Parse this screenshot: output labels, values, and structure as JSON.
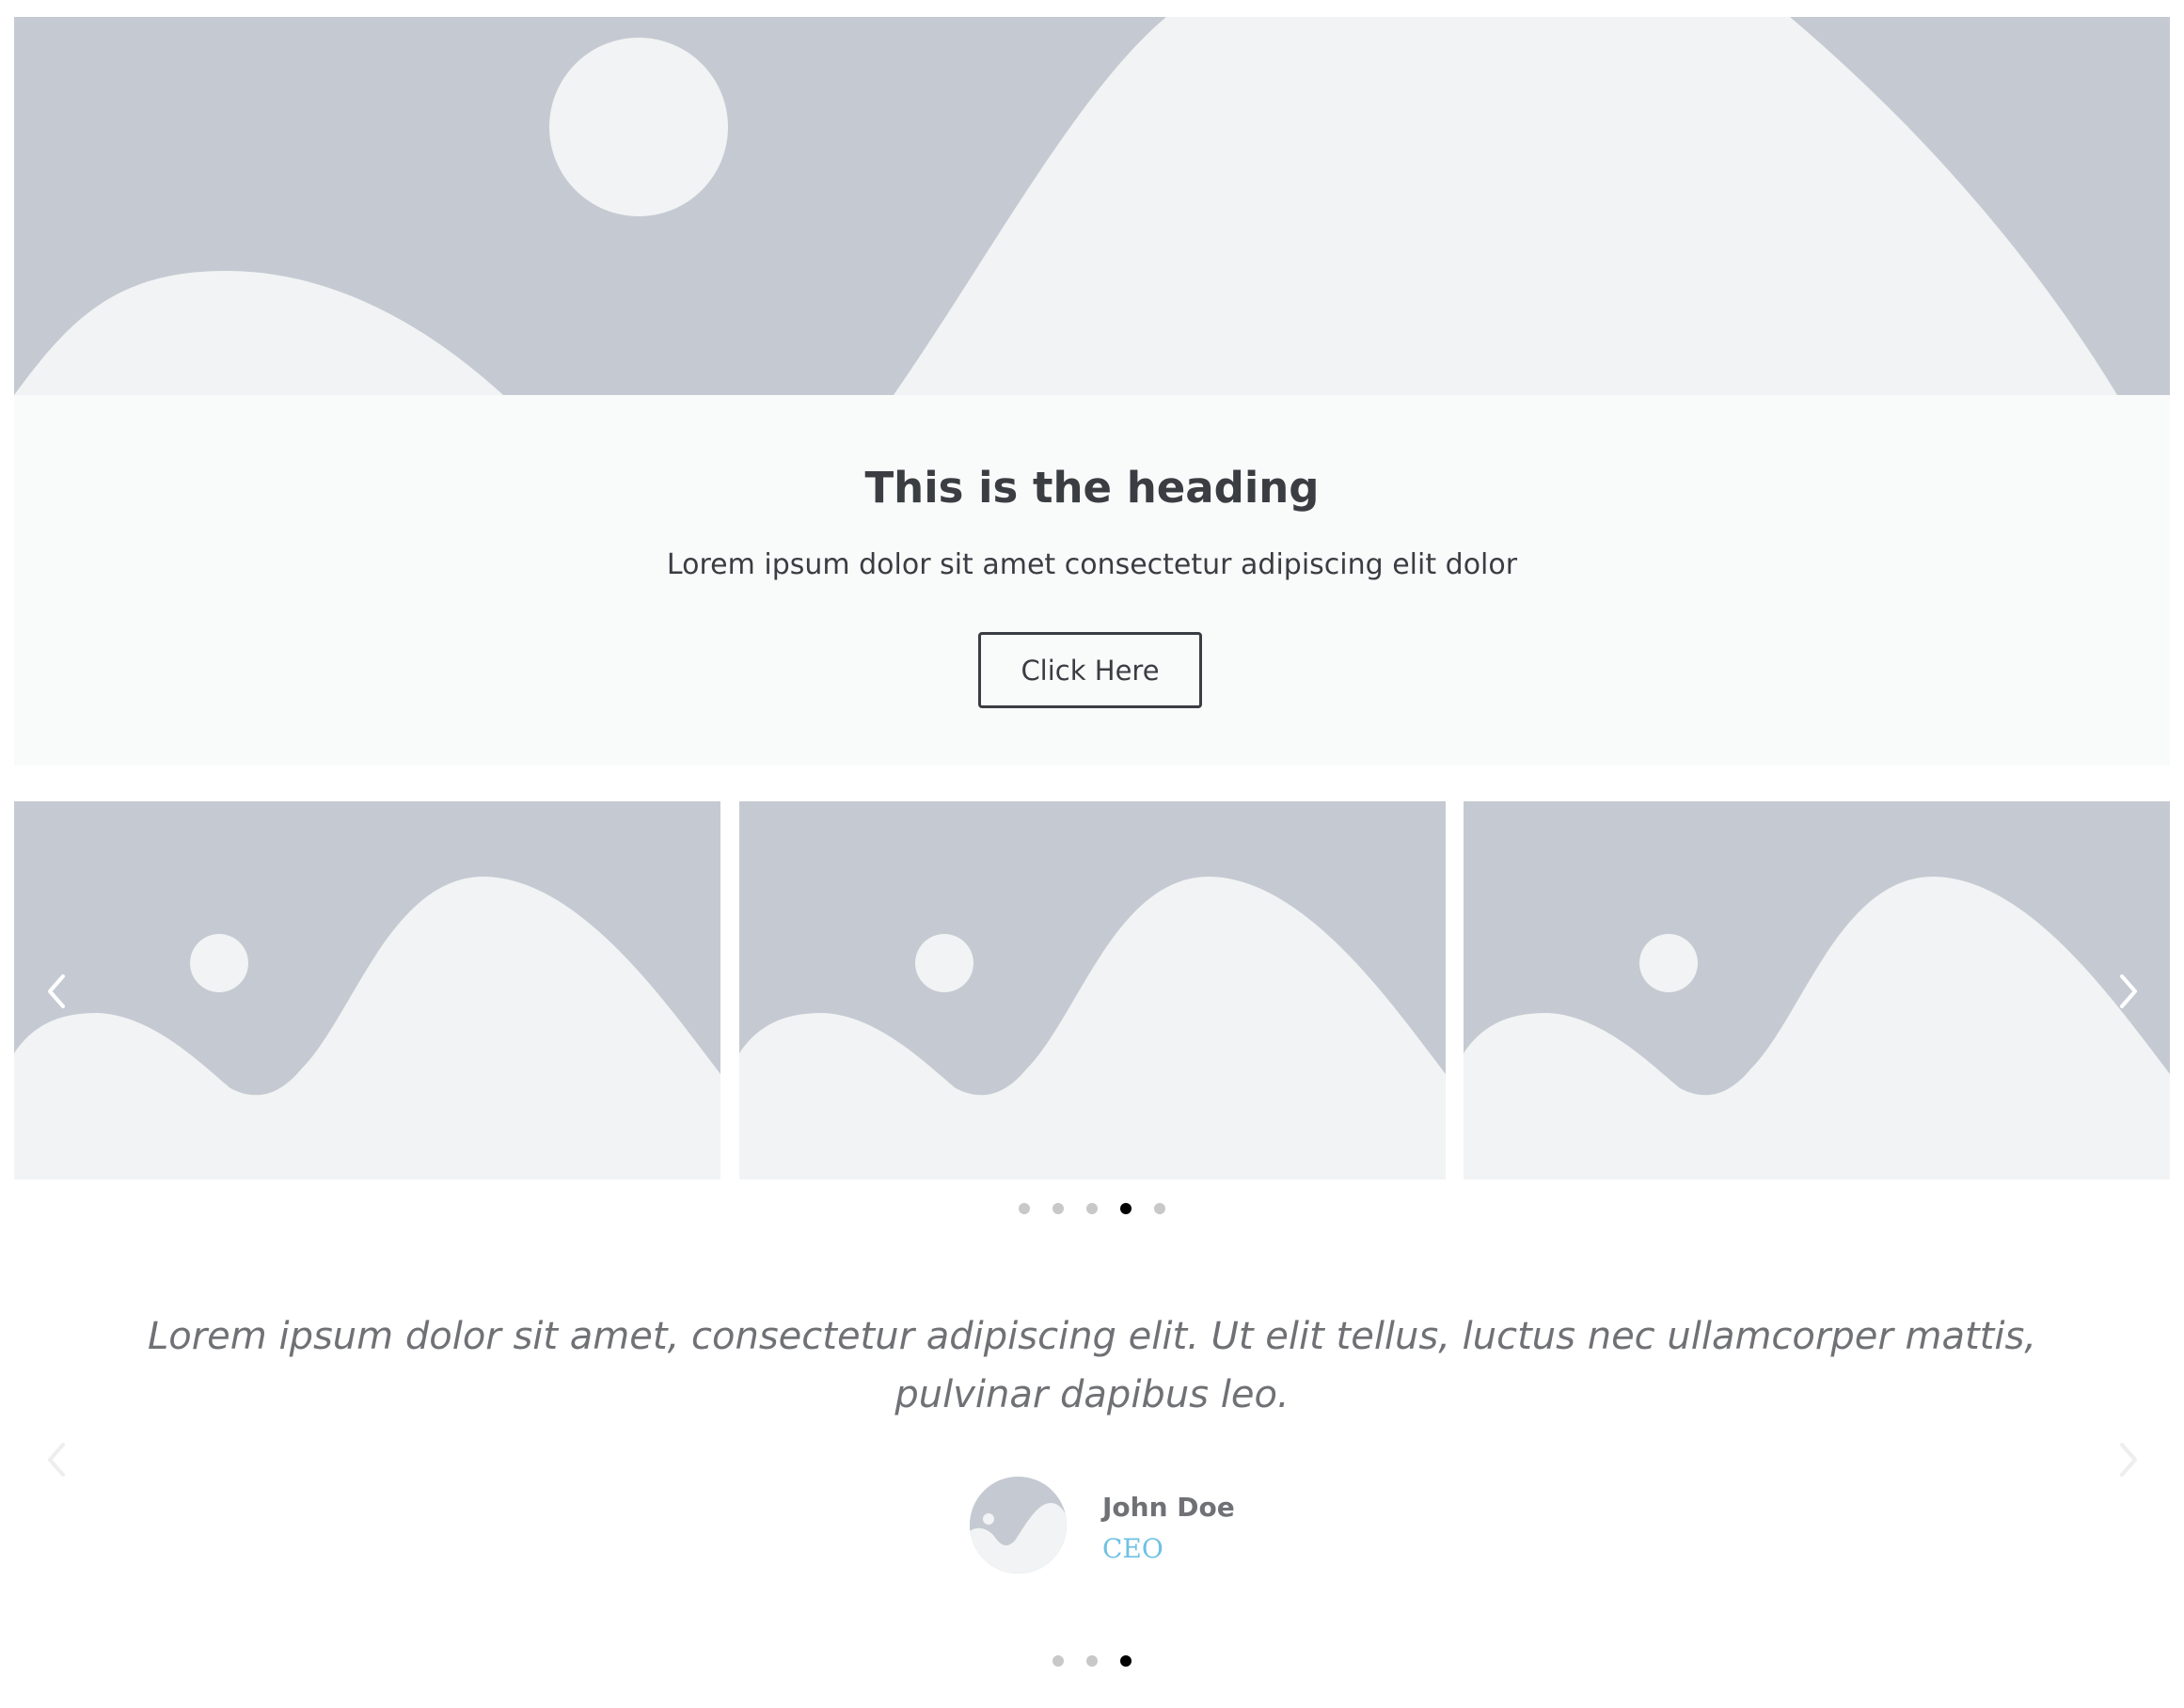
{
  "hero": {
    "heading": "This is the heading",
    "text": "Lorem ipsum dolor sit amet consectetur adipiscing elit dolor",
    "button_label": "Click Here"
  },
  "image_carousel": {
    "slides_visible": 3,
    "dot_count": 5,
    "active_dot": 4,
    "prev_icon": "chevron-left-icon",
    "next_icon": "chevron-right-icon"
  },
  "testimonial": {
    "quote": "Lorem ipsum dolor sit amet, consectetur adipiscing elit. Ut elit tellus, luctus nec ullamcorper mattis, pulvinar dapibus leo.",
    "name": "John Doe",
    "title": "CEO",
    "dot_count": 3,
    "active_dot": 3,
    "prev_icon": "chevron-left-icon",
    "next_icon": "chevron-right-icon"
  },
  "colors": {
    "placeholder_dark": "#c5cad2",
    "placeholder_light": "#f1f3f4",
    "hero_content_bg": "#f9fafa",
    "text_dark": "#3a3d42",
    "text_muted": "#6f7175",
    "accent": "#6ec1e4",
    "dot_inactive": "#c8c8c8",
    "dot_active": "#000000"
  }
}
